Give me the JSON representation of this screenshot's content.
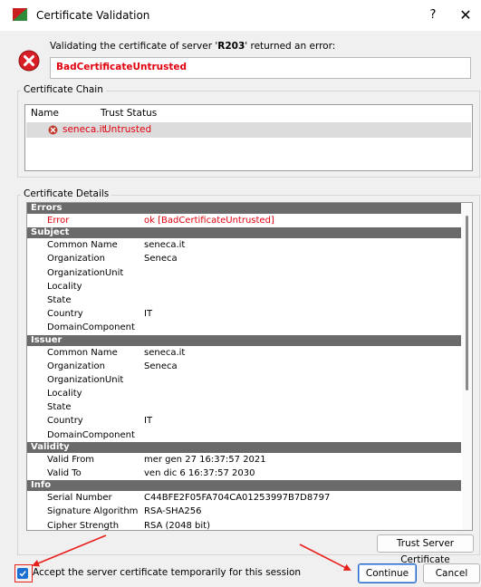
{
  "window": {
    "title": "Certificate Validation",
    "help_label": "?",
    "close_label": "✕"
  },
  "error": {
    "intro_prefix": "Validating the certificate of server '",
    "server": "R203",
    "intro_suffix": "' returned an error:",
    "code": "BadCertificateUntrusted"
  },
  "chain": {
    "title": "Certificate Chain",
    "columns": [
      "Name",
      "Trust Status"
    ],
    "rows": [
      {
        "name": "seneca.it",
        "status": "Untrusted"
      }
    ]
  },
  "details": {
    "title": "Certificate Details",
    "sections": [
      {
        "title": "Errors",
        "rows": [
          {
            "key": "Error",
            "value": "ok [BadCertificateUntrusted]",
            "highlight": true
          }
        ]
      },
      {
        "title": "Subject",
        "rows": [
          {
            "key": "Common Name",
            "value": "seneca.it"
          },
          {
            "key": "Organization",
            "value": "Seneca"
          },
          {
            "key": "OrganizationUnit",
            "value": ""
          },
          {
            "key": "Locality",
            "value": ""
          },
          {
            "key": "State",
            "value": ""
          },
          {
            "key": "Country",
            "value": "IT"
          },
          {
            "key": "DomainComponent",
            "value": ""
          }
        ]
      },
      {
        "title": "Issuer",
        "rows": [
          {
            "key": "Common Name",
            "value": "seneca.it"
          },
          {
            "key": "Organization",
            "value": "Seneca"
          },
          {
            "key": "OrganizationUnit",
            "value": ""
          },
          {
            "key": "Locality",
            "value": ""
          },
          {
            "key": "State",
            "value": ""
          },
          {
            "key": "Country",
            "value": "IT"
          },
          {
            "key": "DomainComponent",
            "value": ""
          }
        ]
      },
      {
        "title": "Validity",
        "rows": [
          {
            "key": "Valid From",
            "value": "mer gen 27 16:37:57 2021"
          },
          {
            "key": "Valid To",
            "value": "ven dic 6 16:37:57 2030"
          }
        ]
      },
      {
        "title": "Info",
        "rows": [
          {
            "key": "Serial Number",
            "value": "C44BFE2F05FA704CA01253997B7D8797"
          },
          {
            "key": "Signature Algorithm",
            "value": "RSA-SHA256"
          },
          {
            "key": "Cipher Strength",
            "value": "RSA (2048 bit)"
          }
        ]
      }
    ]
  },
  "buttons": {
    "trust": "Trust Server Certificate",
    "continue": "Continue",
    "cancel": "Cancel"
  },
  "accept_checkbox": {
    "label": "Accept the server certificate temporarily for this session",
    "checked": true
  },
  "colors": {
    "error_red": "#e0000d",
    "section_header": "#6a6a6a",
    "annotation_red": "#e8201c",
    "accent_blue": "#1b6fd3"
  }
}
